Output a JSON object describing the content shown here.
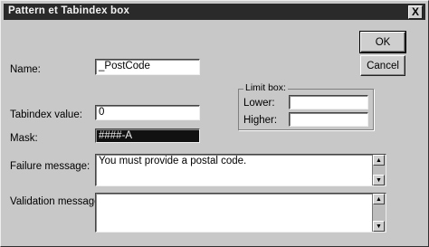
{
  "window": {
    "title": "Pattern et Tabindex box",
    "close_glyph": "X"
  },
  "buttons": {
    "ok_label": "OK",
    "cancel_label": "Cancel"
  },
  "fields": {
    "name_label": "Name:",
    "name_value": "_PostCode",
    "tab_index_label": "Tabindex value:",
    "tab_index_value": "0",
    "pattern_label": "Mask:",
    "pattern_value": "####-A",
    "failure_message_label": "Failure message:",
    "failure_message_value": "You must provide a postal code.",
    "validation_message_label": "Validation message:",
    "validation_message_value": ""
  },
  "limits": {
    "group_label": "Limit box:",
    "lower_label": "Lower:",
    "lower_value": "",
    "upper_label": "Higher:",
    "upper_value": ""
  }
}
